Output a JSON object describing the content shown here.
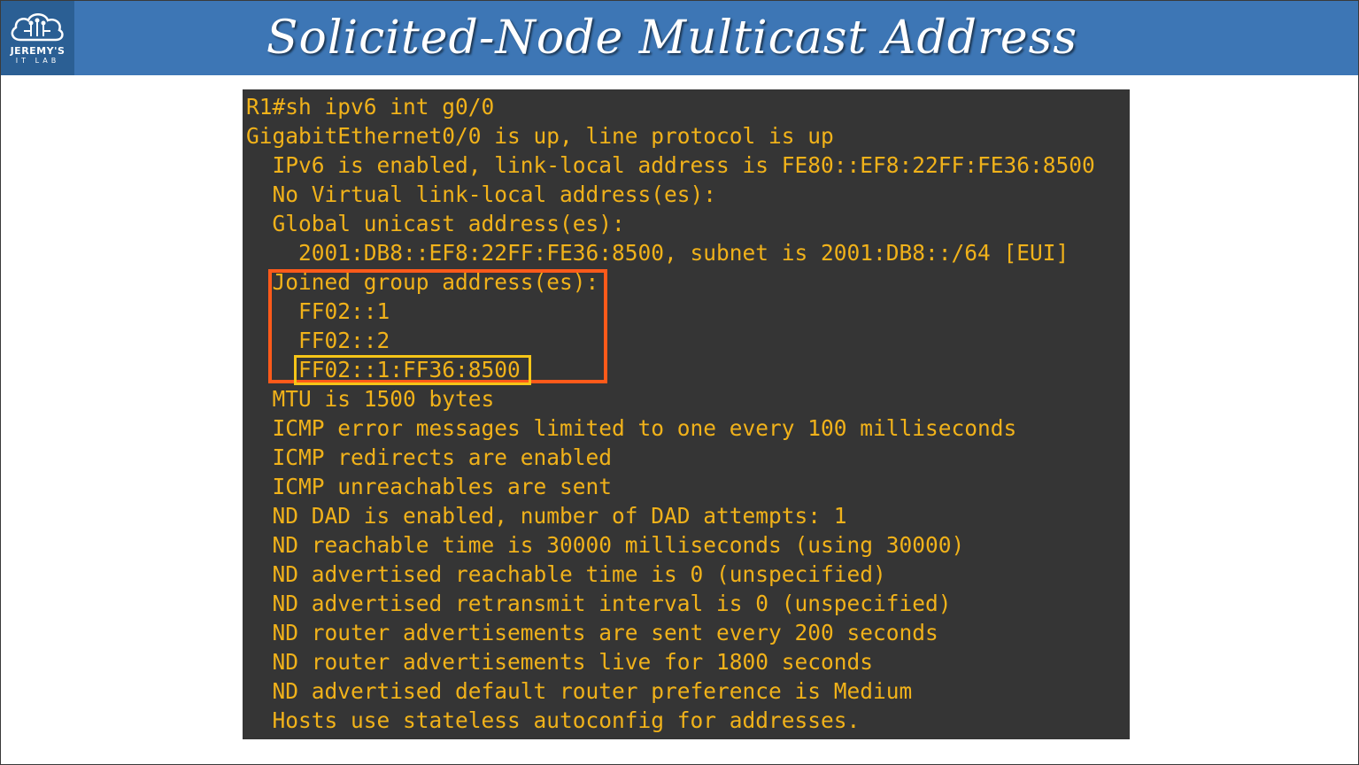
{
  "header": {
    "title": "Solicited-Node Multicast Address",
    "logo": {
      "line1": "JEREMY'S",
      "line2": "IT LAB",
      "icon": "cloud-circuit-icon"
    }
  },
  "colors": {
    "header_bg": "#3d76b5",
    "terminal_bg": "#353535",
    "terminal_text": "#f1b21a",
    "highlight_outer": "#ff5a1a",
    "highlight_inner": "#f5c518"
  },
  "terminal": {
    "lines": [
      "R1#sh ipv6 int g0/0",
      "GigabitEthernet0/0 is up, line protocol is up",
      "  IPv6 is enabled, link-local address is FE80::EF8:22FF:FE36:8500",
      "  No Virtual link-local address(es):",
      "  Global unicast address(es):",
      "    2001:DB8::EF8:22FF:FE36:8500, subnet is 2001:DB8::/64 [EUI]",
      "  Joined group address(es):",
      "    FF02::1",
      "    FF02::2",
      "    FF02::1:FF36:8500",
      "  MTU is 1500 bytes",
      "  ICMP error messages limited to one every 100 milliseconds",
      "  ICMP redirects are enabled",
      "  ICMP unreachables are sent",
      "  ND DAD is enabled, number of DAD attempts: 1",
      "  ND reachable time is 30000 milliseconds (using 30000)",
      "  ND advertised reachable time is 0 (unspecified)",
      "  ND advertised retransmit interval is 0 (unspecified)",
      "  ND router advertisements are sent every 200 seconds",
      "  ND router advertisements live for 1800 seconds",
      "  ND advertised default router preference is Medium",
      "  Hosts use stateless autoconfig for addresses."
    ]
  }
}
